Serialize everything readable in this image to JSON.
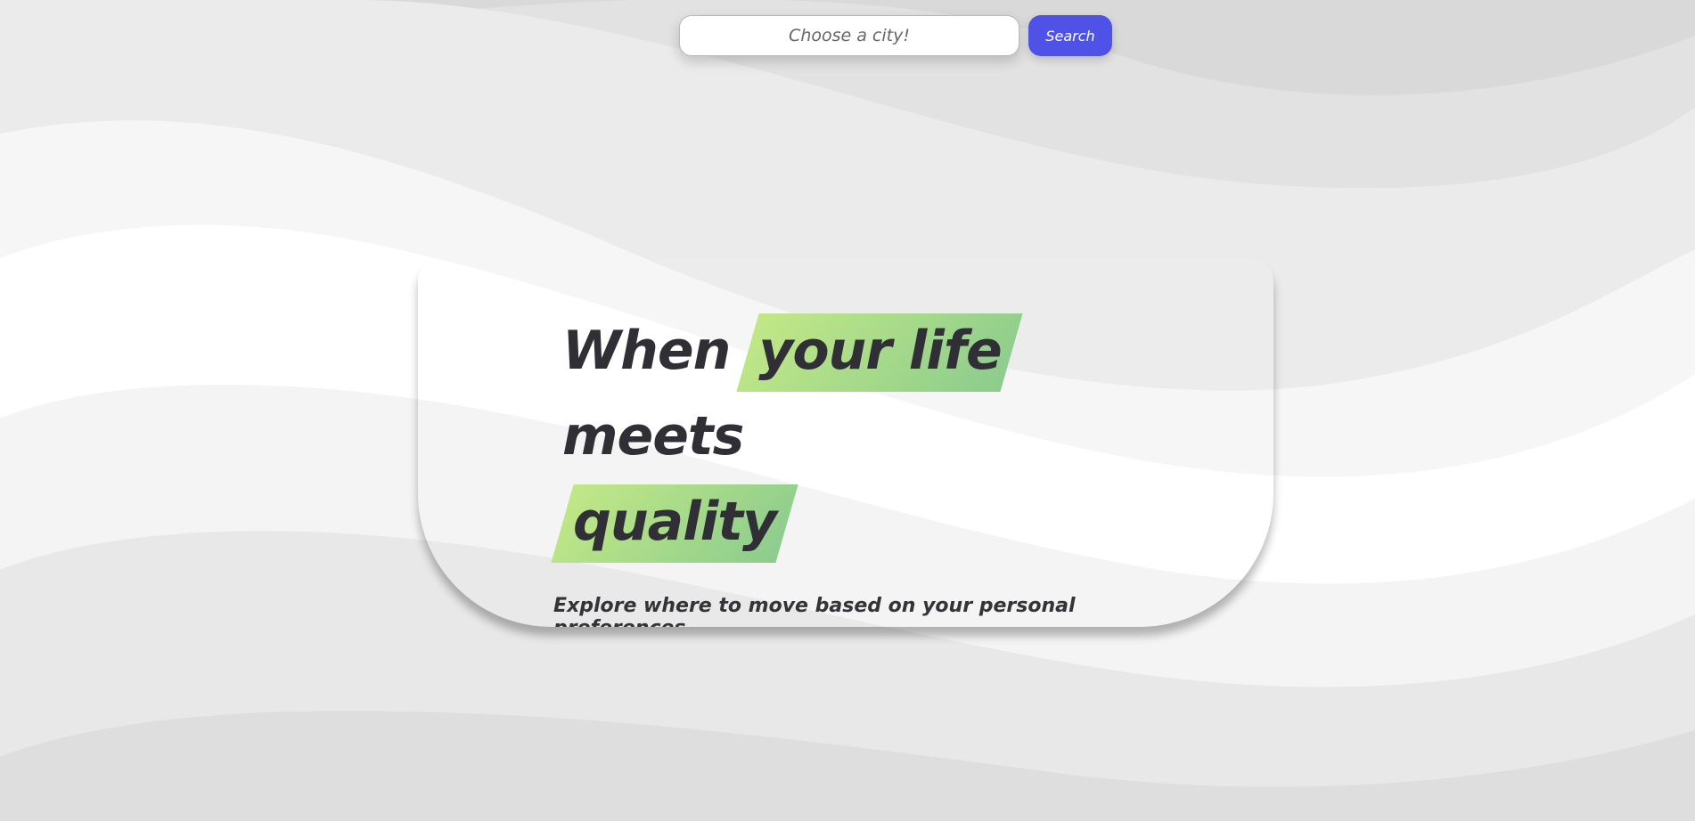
{
  "search": {
    "placeholder": "Choose a city!",
    "button_label": "Search"
  },
  "hero": {
    "headline_part1": "When",
    "headline_highlight1": "your life",
    "headline_part2": "meets",
    "headline_highlight2": "quality",
    "subtitle": "Explore where to move based on your personal preferences."
  },
  "colors": {
    "accent": "#4f52e6",
    "highlight_start": "#c2e886",
    "highlight_end": "#8ccc8e",
    "text": "#2f2f35"
  }
}
